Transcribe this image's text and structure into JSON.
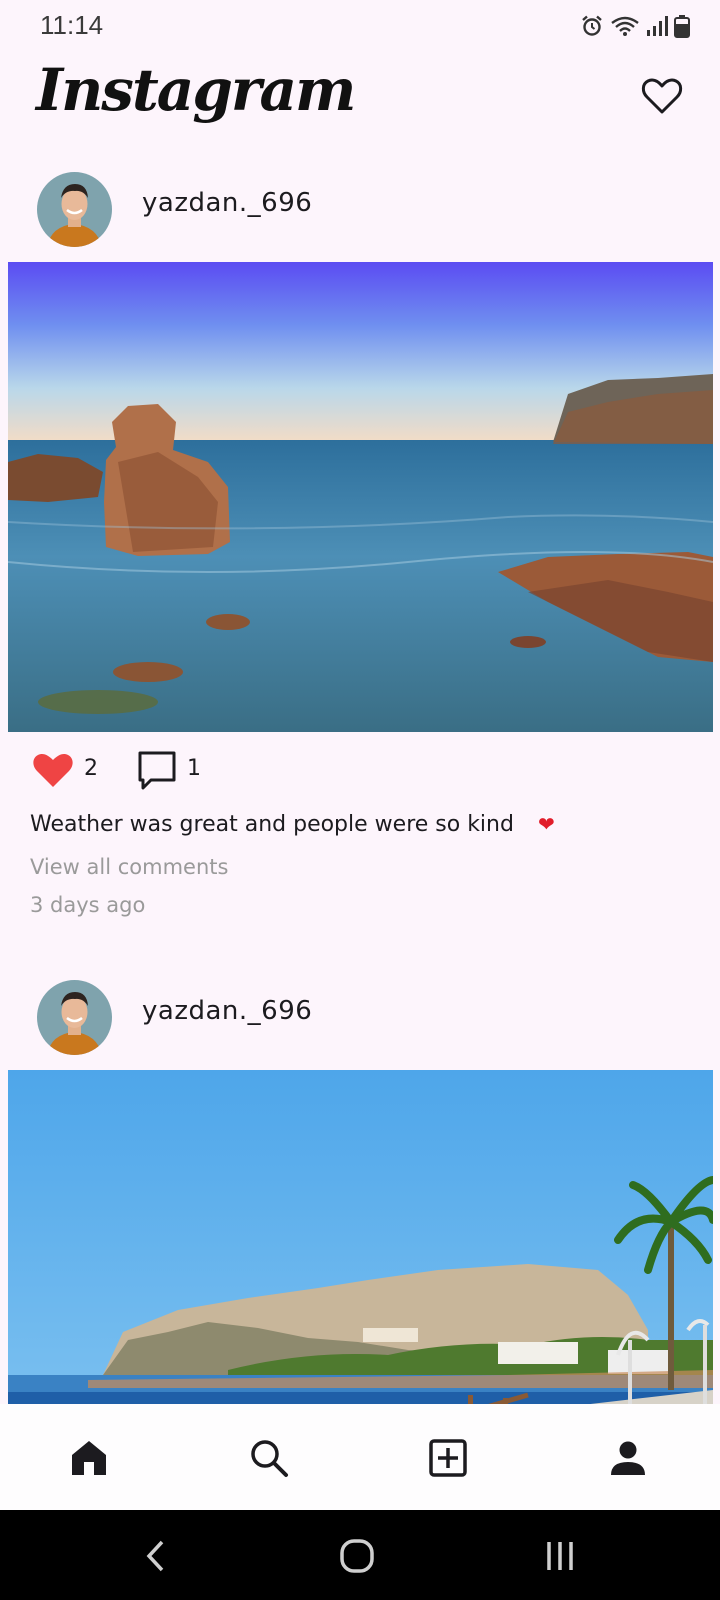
{
  "status_bar": {
    "time": "11:14",
    "icons": [
      "alarm-icon",
      "wifi-icon",
      "signal-icon",
      "battery-icon"
    ]
  },
  "header": {
    "logo": "Instagram",
    "notifications_icon": "heart-outline-icon"
  },
  "posts": [
    {
      "username": "yazdan._696",
      "image": "rocky-coast-sunset-photo",
      "likes": "2",
      "comments": "1",
      "caption": "Weather was great and people were so kind",
      "caption_emoji": "❤",
      "view_comments": "View all comments",
      "time_ago": "3 days ago"
    },
    {
      "username": "yazdan._696",
      "image": "coastal-town-palms-photo"
    }
  ],
  "bottom_nav": [
    "home-icon",
    "search-icon",
    "add-post-icon",
    "profile-icon"
  ],
  "system_nav": [
    "back-icon",
    "home-circle-icon",
    "recents-icon"
  ],
  "colors": {
    "background": "#fdf5fc",
    "like_red": "#ef4444",
    "muted_text": "#9a9a9a"
  }
}
